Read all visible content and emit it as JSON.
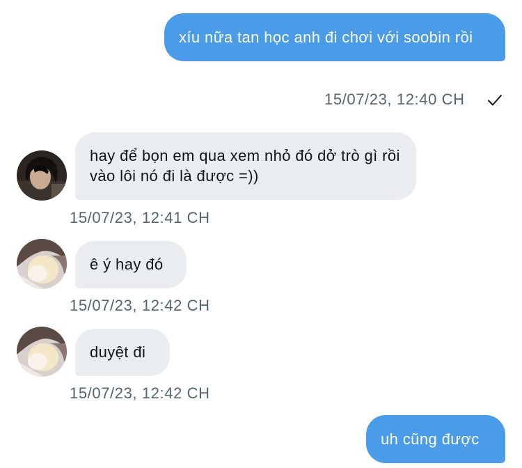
{
  "messages": [
    {
      "direction": "sent",
      "text": "xíu nữa tan học anh đi chơi với soobin rồi",
      "timestamp": "15/07/23, 12:40 CH",
      "read_icon": "checkmark-icon"
    },
    {
      "direction": "received",
      "sender_avatar": "dark-hair-avatar",
      "text": "hay để bọn em qua xem nhỏ đó dở trò gì rồi vào lôi nó đi là được =))",
      "timestamp": "15/07/23, 12:41 CH"
    },
    {
      "direction": "received",
      "sender_avatar": "blonde-hair-avatar",
      "text": "ê ý hay đó",
      "timestamp": "15/07/23, 12:42 CH"
    },
    {
      "direction": "received",
      "sender_avatar": "blonde-hair-avatar",
      "text": "duyệt đi",
      "timestamp": "15/07/23, 12:42 CH"
    },
    {
      "direction": "sent",
      "text": "uh cũng được"
    }
  ],
  "colors": {
    "sent_bubble": "#4a9be8",
    "received_bubble": "#eaedf0",
    "timestamp": "#536471"
  }
}
